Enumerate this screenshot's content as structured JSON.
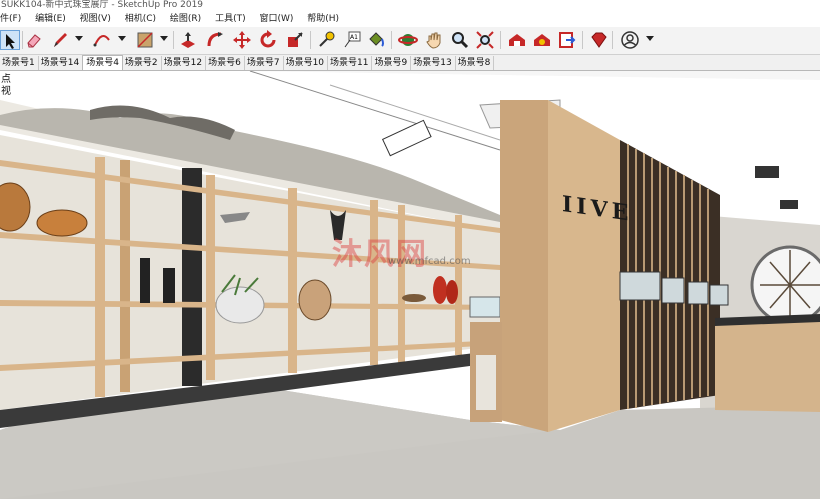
{
  "window": {
    "title": "SUKK104-新中式珠宝展厅 - SketchUp Pro 2019"
  },
  "menu": {
    "items": [
      "件(F)",
      "编辑(E)",
      "视图(V)",
      "相机(C)",
      "绘图(R)",
      "工具(T)",
      "窗口(W)",
      "帮助(H)"
    ]
  },
  "toolbar": {
    "tools": [
      "select-icon",
      "eraser-icon",
      "pencil-line-icon",
      "arc-icon",
      "rectangle-icon",
      "push-pull-icon",
      "follow-me-icon",
      "move-icon",
      "rotate-icon",
      "scale-icon",
      "tape-measure-icon",
      "text-icon",
      "paint-bucket-icon",
      "orbit-icon",
      "pan-icon",
      "zoom-icon",
      "zoom-extents-icon",
      "warehouse-icon",
      "extension-warehouse-icon",
      "send-to-layout-icon",
      "ruby-icon",
      "account-icon"
    ]
  },
  "scenes": {
    "tabs": [
      "场景号1",
      "场景号14",
      "场景号4",
      "场景号2",
      "场景号12",
      "场景号6",
      "场景号7",
      "场景号10",
      "场景号11",
      "场景号9",
      "场景号13",
      "场景号8"
    ],
    "active_index": 2
  },
  "viewport": {
    "scene_hint": "点视",
    "wall_sign": "IIVE",
    "watermark": "沐风网",
    "watermark_url": "www.mfcad.com"
  }
}
